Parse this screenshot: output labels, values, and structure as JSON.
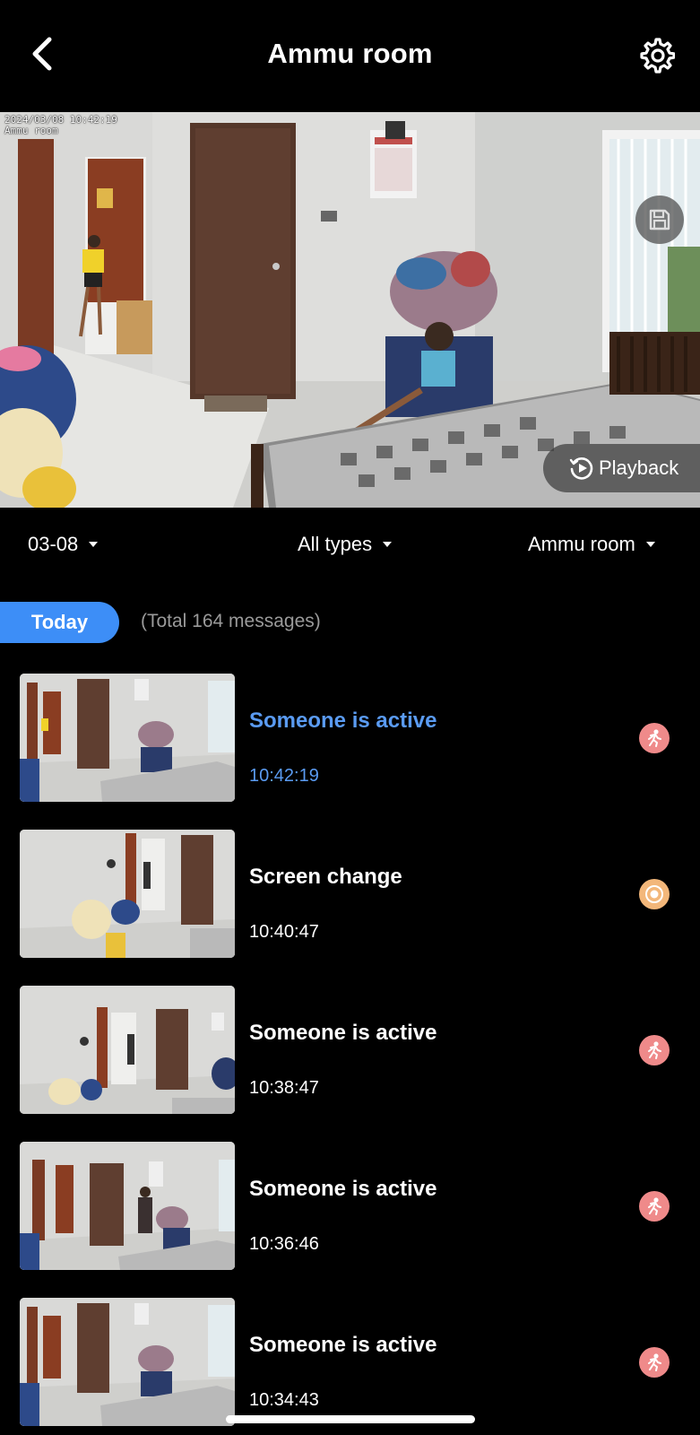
{
  "header": {
    "title": "Ammu room",
    "back_icon": "chevron-left-icon",
    "settings_icon": "gear-icon"
  },
  "live_view": {
    "osd_timestamp": "2024/03/08 10:42:19",
    "osd_camera": "Ammu room",
    "save_icon": "floppy-disk-icon",
    "playback_label": "Playback",
    "playback_icon": "replay-circle-icon"
  },
  "filters": {
    "date": "03-08",
    "type": "All types",
    "camera": "Ammu room"
  },
  "list_header": {
    "today_label": "Today",
    "total_label": "(Total 164 messages)"
  },
  "colors": {
    "accent_blue": "#3d8ef7",
    "active_text": "#5a9bf2",
    "motion_badge": "#ef8a8a",
    "screen_change_badge": "#f3b77a"
  },
  "events": [
    {
      "title": "Someone is active",
      "time": "10:42:19",
      "type": "motion",
      "highlighted": true
    },
    {
      "title": "Screen change",
      "time": "10:40:47",
      "type": "screen_change",
      "highlighted": false
    },
    {
      "title": "Someone is active",
      "time": "10:38:47",
      "type": "motion",
      "highlighted": false
    },
    {
      "title": "Someone is active",
      "time": "10:36:46",
      "type": "motion",
      "highlighted": false
    },
    {
      "title": "Someone is active",
      "time": "10:34:43",
      "type": "motion",
      "highlighted": false
    }
  ]
}
